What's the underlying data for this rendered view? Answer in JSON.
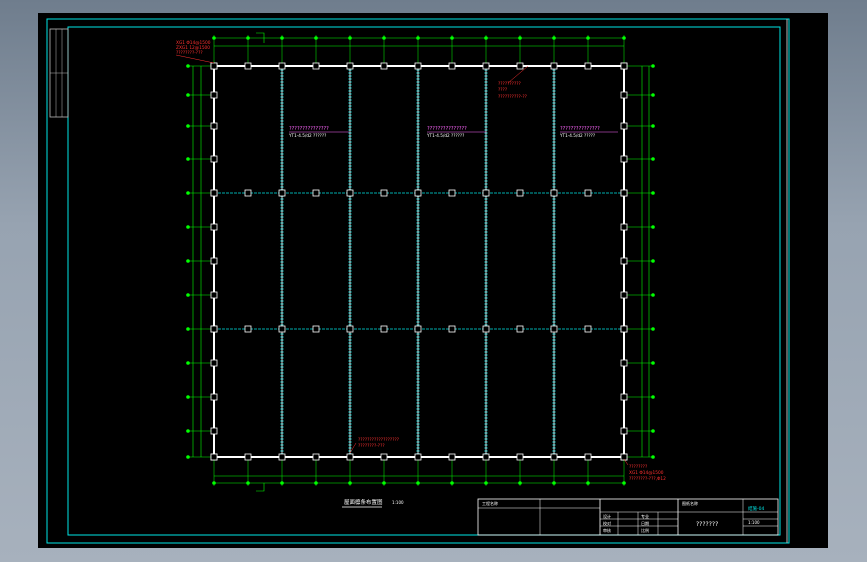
{
  "drawing": {
    "plan_title": "屋面檩条布置图",
    "plan_scale": "1:100",
    "purlin_note_left": "???????????????",
    "purlin_note_left_sub": "YT1-4.5/d2 ??????",
    "purlin_note_mid": "???????????????",
    "purlin_note_mid_sub": "YT1-4.5/d2 ??????",
    "purlin_note_right": "???????????????",
    "purlin_note_right_sub": "YT1-4.5/d2 ?????",
    "tie_note_top_l1": "XG1 Φ14@1500",
    "tie_note_top_l2": "ZXG1 12@1500",
    "tie_note_top_l3": "????????-???",
    "tie_note_mid_l1": "??????????",
    "tie_note_mid_l2": "????",
    "tie_note_mid_l3": "??????????-??",
    "tie_note_bot_l1": "??????????????????",
    "tie_note_bot_l2": "????????-???",
    "tie_note_br_l1": "????????",
    "tie_note_br_l2": "XG1 Φ14@1500",
    "tie_note_br_l3": "????????-???,Φ12"
  },
  "title_block": {
    "project_label": "工程名称",
    "sheet_title": "???????",
    "drawing_no": "结施-04",
    "row1": "设计",
    "row2": "校对",
    "row3": "审核",
    "col2_r1": "专业",
    "col2_r2": "日期",
    "col2_r3": "比例",
    "scale": "1:100",
    "stamp_top": "图纸名称"
  },
  "colors": {
    "frame": "#00e6e6",
    "grid": "#00ff00",
    "beam": "#ffffff",
    "purlin": "#00e6e6",
    "note": "#ff00ff",
    "leader": "#ff2020"
  }
}
